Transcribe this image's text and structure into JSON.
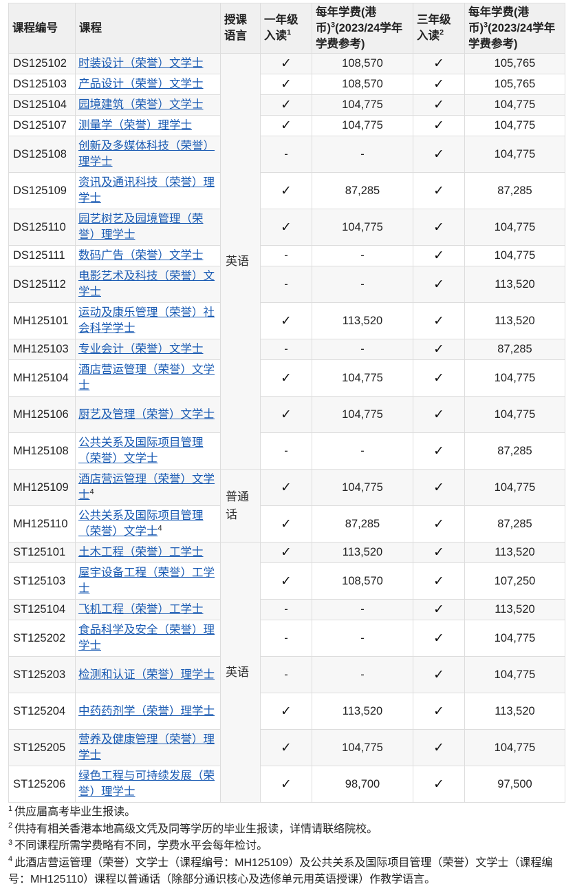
{
  "header": {
    "code": "课程编号",
    "name": "课程",
    "lang": "授课语言",
    "year1": "一年级入读",
    "year1_sup": "1",
    "fee1": "每年学费(港币)",
    "fee1_sup": "3",
    "fee1_sub": "(2023/24学年学费参考)",
    "year3": "三年级入读",
    "year3_sup": "2",
    "fee3": "每年学费(港币)",
    "fee3_sup": "3",
    "fee3_sub": "(2023/24学年学费参考)"
  },
  "lang_groups": [
    {
      "label": "英语",
      "rows": 14
    },
    {
      "label": "普通话",
      "rows": 2
    },
    {
      "label": "英语",
      "rows": 8
    }
  ],
  "rows": [
    {
      "code": "DS125102",
      "name": "时装设计（荣誉）文学士",
      "sup": "",
      "y1": "✓",
      "f1": "108,570",
      "y3": "✓",
      "f3": "105,765",
      "tall": false
    },
    {
      "code": "DS125103",
      "name": "产品设计（荣誉）文学士",
      "sup": "",
      "y1": "✓",
      "f1": "108,570",
      "y3": "✓",
      "f3": "105,765",
      "tall": false
    },
    {
      "code": "DS125104",
      "name": "园境建筑（荣誉）文学士",
      "sup": "",
      "y1": "✓",
      "f1": "104,775",
      "y3": "✓",
      "f3": "104,775",
      "tall": false
    },
    {
      "code": "DS125107",
      "name": "测量学（荣誉）理学士",
      "sup": "",
      "y1": "✓",
      "f1": "104,775",
      "y3": "✓",
      "f3": "104,775",
      "tall": false
    },
    {
      "code": "DS125108",
      "name": "创新及多媒体科技（荣誉）理学士",
      "sup": "",
      "y1": "-",
      "f1": "-",
      "y3": "✓",
      "f3": "104,775",
      "tall": true
    },
    {
      "code": "DS125109",
      "name": "资讯及通讯科技（荣誉）理学士",
      "sup": "",
      "y1": "✓",
      "f1": "87,285",
      "y3": "✓",
      "f3": "87,285",
      "tall": true
    },
    {
      "code": "DS125110",
      "name": "园艺树艺及园境管理（荣誉）理学士",
      "sup": "",
      "y1": "✓",
      "f1": "104,775",
      "y3": "✓",
      "f3": "104,775",
      "tall": true
    },
    {
      "code": "DS125111",
      "name": "数码广告（荣誉）文学士",
      "sup": "",
      "y1": "-",
      "f1": "-",
      "y3": "✓",
      "f3": "104,775",
      "tall": false
    },
    {
      "code": "DS125112",
      "name": "电影艺术及科技（荣誉）文学士",
      "sup": "",
      "y1": "-",
      "f1": "-",
      "y3": "✓",
      "f3": "113,520",
      "tall": true
    },
    {
      "code": "MH125101",
      "name": "运动及康乐管理（荣誉）社会科学学士",
      "sup": "",
      "y1": "✓",
      "f1": "113,520",
      "y3": "✓",
      "f3": "113,520",
      "tall": true
    },
    {
      "code": "MH125103",
      "name": "专业会计（荣誉）文学士",
      "sup": "",
      "y1": "-",
      "f1": "-",
      "y3": "✓",
      "f3": "87,285",
      "tall": false
    },
    {
      "code": "MH125104",
      "name": "酒店营运管理（荣誉）文学士",
      "sup": "",
      "y1": "✓",
      "f1": "104,775",
      "y3": "✓",
      "f3": "104,775",
      "tall": true
    },
    {
      "code": "MH125106",
      "name": "厨艺及管理（荣誉）文学士",
      "sup": "",
      "y1": "✓",
      "f1": "104,775",
      "y3": "✓",
      "f3": "104,775",
      "tall": true
    },
    {
      "code": "MH125108",
      "name": "公共关系及国际项目管理（荣誉）文学士",
      "sup": "",
      "y1": "-",
      "f1": "-",
      "y3": "✓",
      "f3": "87,285",
      "tall": true
    },
    {
      "code": "MH125109",
      "name": "酒店营运管理（荣誉）文学士",
      "sup": "4",
      "y1": "✓",
      "f1": "104,775",
      "y3": "✓",
      "f3": "104,775",
      "tall": true
    },
    {
      "code": "MH125110",
      "name": "公共关系及国际项目管理（荣誉）文学士",
      "sup": "4",
      "y1": "✓",
      "f1": "87,285",
      "y3": "✓",
      "f3": "87,285",
      "tall": true
    },
    {
      "code": "ST125101",
      "name": "土木工程（荣誉）工学士",
      "sup": "",
      "y1": "✓",
      "f1": "113,520",
      "y3": "✓",
      "f3": "113,520",
      "tall": false
    },
    {
      "code": "ST125103",
      "name": "屋宇设备工程（荣誉）工学士",
      "sup": "",
      "y1": "✓",
      "f1": "108,570",
      "y3": "✓",
      "f3": "107,250",
      "tall": true
    },
    {
      "code": "ST125104",
      "name": "飞机工程（荣誉）工学士",
      "sup": "",
      "y1": "-",
      "f1": "-",
      "y3": "✓",
      "f3": "113,520",
      "tall": false
    },
    {
      "code": "ST125202",
      "name": "食品科学及安全（荣誉）理学士",
      "sup": "",
      "y1": "-",
      "f1": "-",
      "y3": "✓",
      "f3": "104,775",
      "tall": true
    },
    {
      "code": "ST125203",
      "name": "检测和认证（荣誉）理学士",
      "sup": "",
      "y1": "-",
      "f1": "-",
      "y3": "✓",
      "f3": "104,775",
      "tall": true
    },
    {
      "code": "ST125204",
      "name": "中药药剂学（荣誉）理学士",
      "sup": "",
      "y1": "✓",
      "f1": "113,520",
      "y3": "✓",
      "f3": "113,520",
      "tall": true
    },
    {
      "code": "ST125205",
      "name": "营养及健康管理（荣誉）理学士",
      "sup": "",
      "y1": "✓",
      "f1": "104,775",
      "y3": "✓",
      "f3": "104,775",
      "tall": true
    },
    {
      "code": "ST125206",
      "name": "绿色工程与可持续发展（荣誉）理学士",
      "sup": "",
      "y1": "✓",
      "f1": "98,700",
      "y3": "✓",
      "f3": "97,500",
      "tall": true
    }
  ],
  "notes": [
    {
      "num": "1",
      "text": "供应届高考毕业生报读。"
    },
    {
      "num": "2",
      "text": "供持有相关香港本地高级文凭及同等学历的毕业生报读，详情请联络院校。"
    },
    {
      "num": "3",
      "text": "不同课程所需学费略有不同，学费水平会每年检讨。"
    },
    {
      "num": "4",
      "text": "此酒店营运管理（荣誉）文学士（课程编号：MH125109）及公共关系及国际项目管理（荣誉）文学士（课程编号：MH125110）课程以普通话（除部分通识核心及选修单元用英语授课）作教学语言。"
    }
  ]
}
